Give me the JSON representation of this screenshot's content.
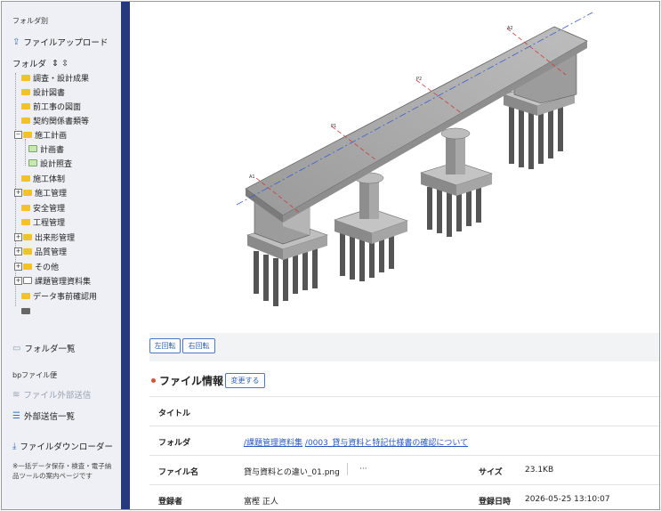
{
  "sidebar": {
    "by_folder_label": "フォルダ別",
    "upload_label": "ファイルアップロード",
    "folder_header": "フォルダ",
    "expand_symbol": "⇕",
    "collapse_symbol": "⇳",
    "tree": [
      {
        "label": "調査・設計成果"
      },
      {
        "label": "設計図書"
      },
      {
        "label": "前工事の図面"
      },
      {
        "label": "契約関係書類等"
      },
      {
        "label": "施工計画",
        "toggle": "−"
      },
      {
        "label": "計画書"
      },
      {
        "label": "設計照査"
      },
      {
        "label": "施工体制"
      },
      {
        "label": "施工管理",
        "toggle": "+"
      },
      {
        "label": "安全管理"
      },
      {
        "label": "工程管理"
      },
      {
        "label": "出来形管理",
        "toggle": "+"
      },
      {
        "label": "品質管理",
        "toggle": "+"
      },
      {
        "label": "その他",
        "toggle": "+"
      },
      {
        "label": "課題管理資料集",
        "toggle": "+"
      },
      {
        "label": "データ事前確認用"
      }
    ],
    "folder_list_label": "フォルダ一覧",
    "bp_label": "bpファイル便",
    "external_send_label": "ファイル外部送信",
    "send_list_label": "外部送信一覧",
    "downloader_label": "ファイルダウンローダー",
    "note": "※一括データ保存・検査・電子納品ツールの案内ページです"
  },
  "viewer": {
    "rotate_left": "左回転",
    "rotate_right": "右回転"
  },
  "info": {
    "title": "ファイル情報",
    "edit_button": "変更する",
    "rows": {
      "title_label": "タイトル",
      "title_value": "",
      "folder_label": "フォルダ",
      "folder_path_1": "/課題管理資料集",
      "folder_path_2": "/0003_貸与資料と特記仕様書の確認について",
      "filename_label": "ファイル名",
      "filename_value": "貸与資料との違い_01.png",
      "more": "···",
      "size_label": "サイズ",
      "size_value": "23.1KB",
      "registrant_label": "登録者",
      "registrant_value": "富樫 正人",
      "registered_at_label": "登録日時",
      "registered_at_value": "2026-05-25 13:10:07"
    }
  },
  "colors": {
    "divider": "#243a7c",
    "link": "#2a56c6",
    "folder": "#f2c22c"
  }
}
